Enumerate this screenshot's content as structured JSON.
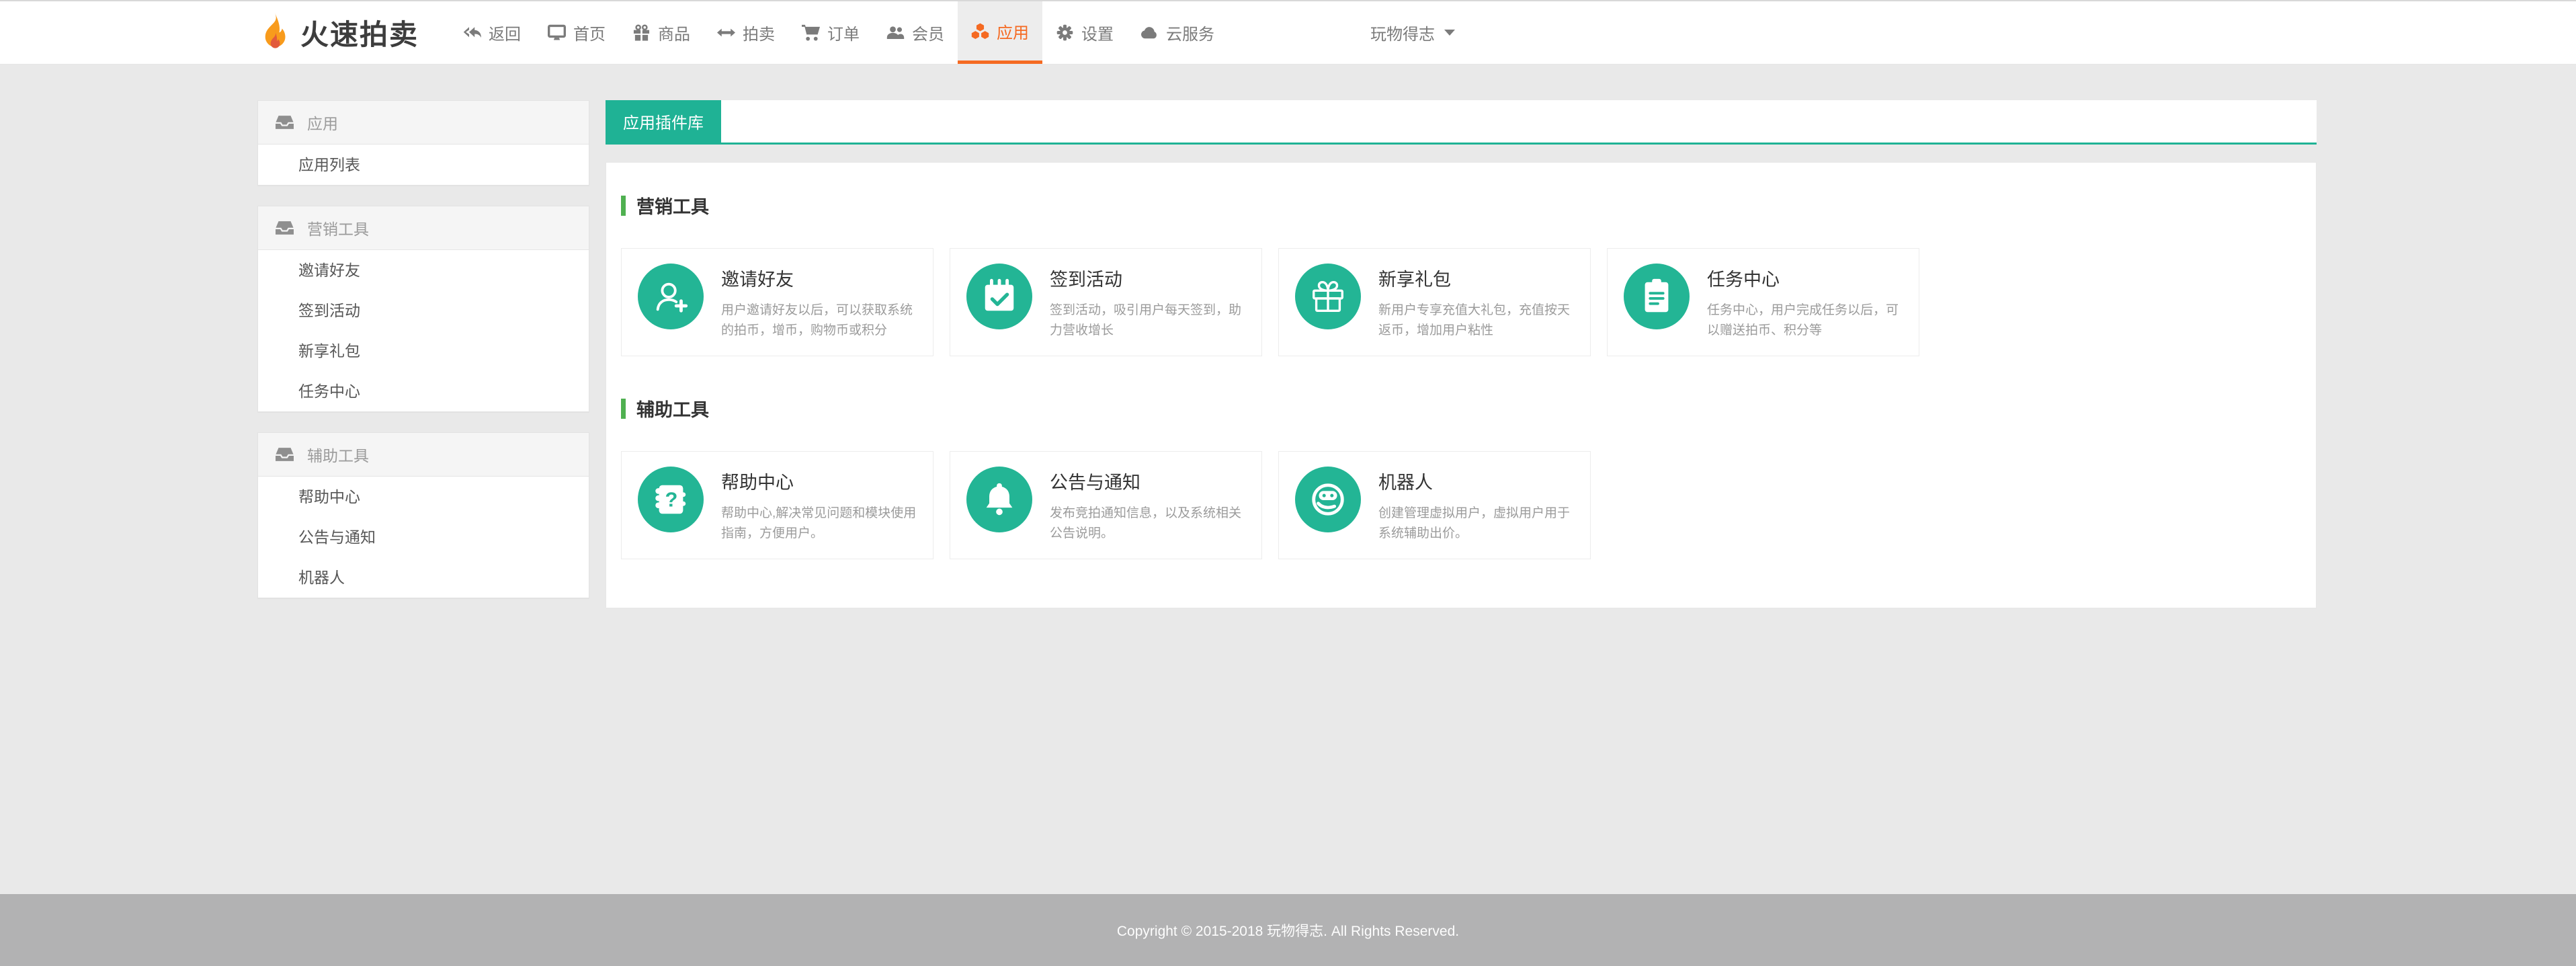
{
  "navbar": {
    "brand": "火速拍卖",
    "items": [
      {
        "label": "返回",
        "icon": "reply-all-icon"
      },
      {
        "label": "首页",
        "icon": "desktop-icon"
      },
      {
        "label": "商品",
        "icon": "gift-icon"
      },
      {
        "label": "拍卖",
        "icon": "arrows-h-icon"
      },
      {
        "label": "订单",
        "icon": "cart-icon"
      },
      {
        "label": "会员",
        "icon": "users-icon"
      },
      {
        "label": "应用",
        "icon": "cubes-icon",
        "active": true
      },
      {
        "label": "设置",
        "icon": "gear-icon"
      },
      {
        "label": "云服务",
        "icon": "cloud-icon"
      }
    ],
    "user_menu": "玩物得志"
  },
  "sidebar": {
    "sections": [
      {
        "title": "应用",
        "items": [
          "应用列表"
        ]
      },
      {
        "title": "营销工具",
        "items": [
          "邀请好友",
          "签到活动",
          "新享礼包",
          "任务中心"
        ]
      },
      {
        "title": "辅助工具",
        "items": [
          "帮助中心",
          "公告与通知",
          "机器人"
        ]
      }
    ]
  },
  "main": {
    "tab": "应用插件库",
    "groups": [
      {
        "title": "营销工具",
        "cards": [
          {
            "name": "邀请好友",
            "desc": "用户邀请好友以后，可以获取系统的拍币，增币，购物币或积分",
            "icon": "user-plus-icon"
          },
          {
            "name": "签到活动",
            "desc": "签到活动，吸引用户每天签到，助力营收增长",
            "icon": "calendar-check-icon"
          },
          {
            "name": "新享礼包",
            "desc": "新用户专享充值大礼包，充值按天返币，增加用户粘性",
            "icon": "gift-box-icon"
          },
          {
            "name": "任务中心",
            "desc": "任务中心，用户完成任务以后，可以赠送拍币、积分等",
            "icon": "task-clipboard-icon"
          }
        ]
      },
      {
        "title": "辅助工具",
        "cards": [
          {
            "name": "帮助中心",
            "desc": "帮助中心,解决常见问题和模块使用指南，方便用户。",
            "icon": "help-book-icon"
          },
          {
            "name": "公告与通知",
            "desc": "发布竞拍通知信息，以及系统相关公告说明。",
            "icon": "bell-icon"
          },
          {
            "name": "机器人",
            "desc": "创建管理虚拟用户，虚拟用户用于系统辅助出价。",
            "icon": "robot-icon"
          }
        ]
      }
    ]
  },
  "footer": {
    "copyright": "Copyright © 2015-2018 玩物得志. All Rights Reserved."
  },
  "colors": {
    "accent_orange": "#f56a22",
    "teal": "#1fb295",
    "section_green": "#4fb050",
    "footer_gray": "#b2b2b3"
  }
}
